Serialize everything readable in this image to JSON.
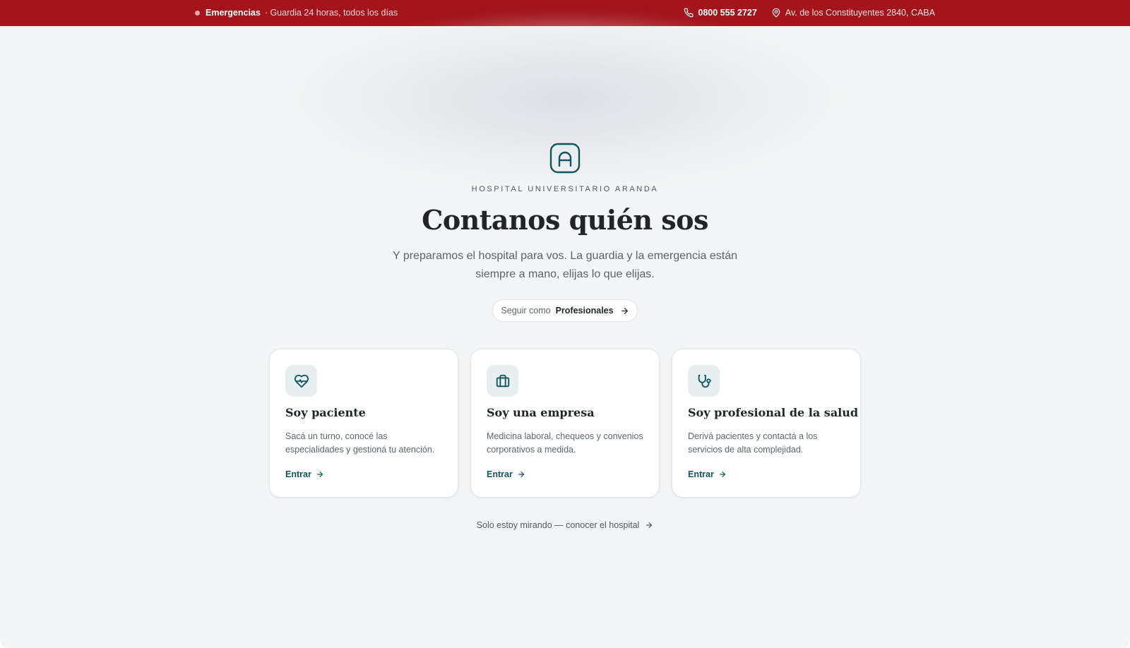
{
  "topbar": {
    "emergency_label": "Emergencias",
    "emergency_note": "· Guardia 24 horas, todos los días",
    "phone": "0800 555 2727",
    "address": "Av. de los Constituyentes 2840, CABA",
    "background": "#a3141b"
  },
  "hero": {
    "logo_icon": "hospital-logo-icon",
    "org_name": "HOSPITAL UNIVERSITARIO ARANDA",
    "title": "Contanos quién sos",
    "subtitle": "Y preparamos el hospital para vos. La guardia y la emergencia están siempre a mano, elijas lo que elijas.",
    "pill": {
      "prefix": "Seguir como",
      "value": "Profesionales"
    }
  },
  "cards": [
    {
      "icon": "heart-pulse-icon",
      "title": "Soy paciente",
      "description": "Sacá un turno, conocé las especialidades y gestioná tu atención.",
      "link": "Entrar"
    },
    {
      "icon": "briefcase-icon",
      "title": "Soy una empresa",
      "description": "Medicina laboral, chequeos y convenios corporativos a medida.",
      "link": "Entrar"
    },
    {
      "icon": "stethoscope-icon",
      "title": "Soy profesional de la salud",
      "description": "Derivá pacientes y contactá a los servicios de alta complejidad.",
      "link": "Entrar"
    }
  ],
  "footer_link": "Solo estoy mirando — conocer el hospital",
  "colors": {
    "accent": "#0f5561",
    "emergency": "#a3141b",
    "page_bg": "#f2f4f5"
  }
}
